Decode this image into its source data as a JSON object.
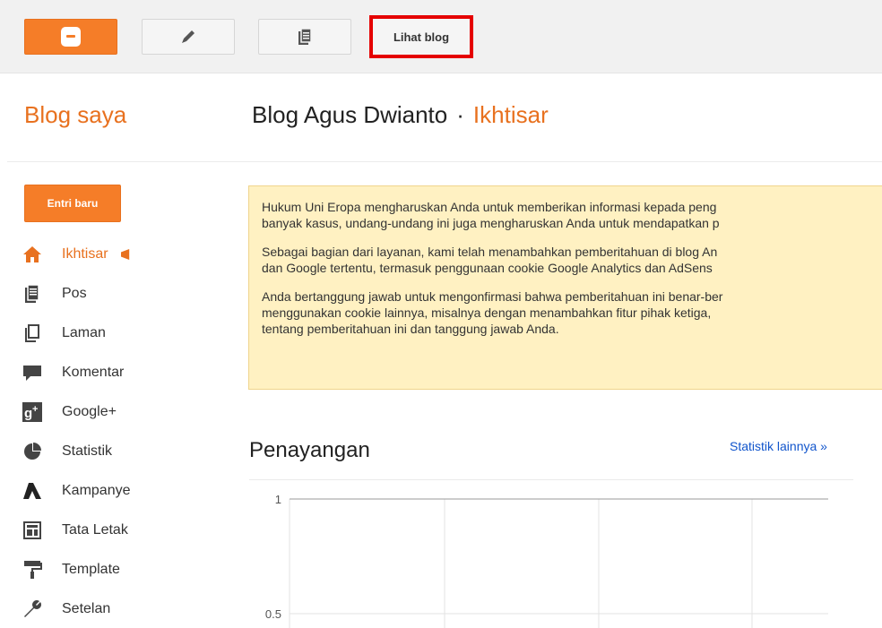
{
  "topbar": {
    "logo_icon": "blogger-logo-icon",
    "pencil_icon": "pencil-icon",
    "pages_icon": "pages-icon",
    "view_blog_label": "Lihat blog"
  },
  "header": {
    "brand": "Blog saya",
    "blog_title": "Blog Agus Dwianto",
    "separator": "·",
    "section": "Ikhtisar"
  },
  "sidebar": {
    "new_post_label": "Entri baru",
    "items": [
      {
        "label": "Ikhtisar",
        "icon": "home-icon"
      },
      {
        "label": "Pos",
        "icon": "posts-icon"
      },
      {
        "label": "Laman",
        "icon": "page-icon"
      },
      {
        "label": "Komentar",
        "icon": "comment-icon"
      },
      {
        "label": "Google+",
        "icon": "google-plus-icon"
      },
      {
        "label": "Statistik",
        "icon": "pie-chart-icon"
      },
      {
        "label": "Kampanye",
        "icon": "campaign-icon"
      },
      {
        "label": "Tata Letak",
        "icon": "layout-icon"
      },
      {
        "label": "Template",
        "icon": "paint-roller-icon"
      },
      {
        "label": "Setelan",
        "icon": "wrench-icon"
      }
    ]
  },
  "notice": {
    "p1_line1": "Hukum Uni Eropa mengharuskan Anda untuk memberikan informasi kepada peng",
    "p1_line2": "banyak kasus, undang-undang ini juga mengharuskan Anda untuk mendapatkan p",
    "p2_line1": "Sebagai bagian dari layanan, kami telah menambahkan pemberitahuan di blog An",
    "p2_line2": "dan Google tertentu, termasuk penggunaan cookie Google Analytics dan AdSens",
    "p3_line1": "Anda bertanggung jawab untuk mengonfirmasi bahwa pemberitahuan ini benar-ber",
    "p3_line2": "menggunakan cookie lainnya, misalnya dengan menambahkan fitur pihak ketiga, ",
    "p3_line3": "tentang pemberitahuan ini dan tanggung jawab Anda."
  },
  "stats": {
    "title": "Penayangan",
    "more_link": "Statistik lainnya »"
  },
  "chart_data": {
    "type": "line",
    "title": "",
    "xlabel": "",
    "ylabel": "",
    "y_ticks": [
      "1",
      "0.5"
    ],
    "ylim": [
      0.5,
      1
    ],
    "grid": true,
    "series": []
  },
  "colors": {
    "accent": "#e8711f",
    "notice_bg": "#fff1c2",
    "link": "#1155cc",
    "highlight_border": "#e50000"
  }
}
